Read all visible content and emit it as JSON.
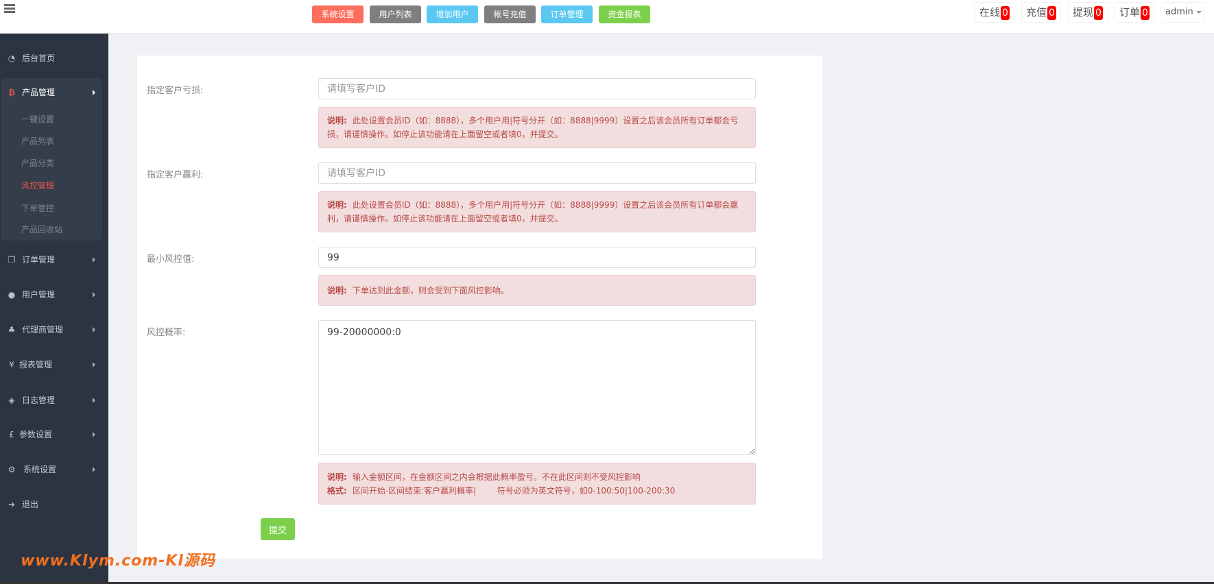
{
  "top": {
    "buttons": [
      {
        "label": "系统设置",
        "color": "#ff6d5e"
      },
      {
        "label": "用户列表",
        "color": "#7f7f7f"
      },
      {
        "label": "增加用户",
        "color": "#5bc8f2"
      },
      {
        "label": "帐号充值",
        "color": "#7f7f7f"
      },
      {
        "label": "订单管理",
        "color": "#5bc8f2"
      },
      {
        "label": "资金报表",
        "color": "#7cd04c"
      }
    ],
    "stats": [
      {
        "label": "在线",
        "count": "0"
      },
      {
        "label": "充值",
        "count": "0"
      },
      {
        "label": "提现",
        "count": "0"
      },
      {
        "label": "订单",
        "count": "0"
      }
    ],
    "user": "admin"
  },
  "sidebar": {
    "items": [
      {
        "label": "后台首页",
        "icon": "dashboard-icon"
      },
      {
        "label": "产品管理",
        "icon": "bitcoin-icon"
      },
      {
        "label": "订单管理",
        "icon": "copy-icon"
      },
      {
        "label": "用户管理",
        "icon": "user-icon"
      },
      {
        "label": "代理商管理",
        "icon": "sitemap-icon"
      },
      {
        "label": "报表管理",
        "icon": "yen-icon"
      },
      {
        "label": "日志管理",
        "icon": "ticket-icon"
      },
      {
        "label": "参数设置",
        "icon": "pound-icon"
      },
      {
        "label": "系统设置",
        "icon": "gears-icon"
      },
      {
        "label": "退出",
        "icon": "sign-out-icon"
      }
    ],
    "sub_items": [
      "一键设置",
      "产品列表",
      "产品分类",
      "风控管理",
      "下单管控",
      "产品回收站"
    ],
    "active_sub": "风控管理",
    "active_color": "#e8554e"
  },
  "form": {
    "loss": {
      "label": "指定客户亏损:",
      "placeholder": "请填写客户ID",
      "value": "",
      "note_title": "说明:",
      "note": "此处设置会员ID（如：8888），多个用户用|符号分开（如：8888|9999）设置之后该会员所有订单都会亏损，请谨慎操作。如停止该功能请在上面留空或者填0，并提交。"
    },
    "win": {
      "label": "指定客户赢利:",
      "placeholder": "请填写客户ID",
      "value": "",
      "note_title": "说明:",
      "note": "此处设置会员ID（如：8888），多个用户用|符号分开（如：8888|9999）设置之后该会员所有订单都会赢利，请谨慎操作。如停止该功能请在上面留空或者填0，并提交。"
    },
    "min": {
      "label": "最小风控值:",
      "value": "99",
      "note_title": "说明:",
      "note": "下单达到此金额，则会受到下面风控影响。"
    },
    "rate": {
      "label": "风控概率:",
      "value": "99-20000000:0",
      "note_title": "说明:",
      "note": "输入金额区间，在金额区间之内会根据此概率盈亏。不在此区间则不受风控影响",
      "format_title": "格式:",
      "format": "区间开始-区间结束:客户赢利概率|        符号必须为英文符号，如0-100:50|100-200:30"
    },
    "submit": "提交"
  },
  "watermark": "www.Klym.com-Kl源码"
}
